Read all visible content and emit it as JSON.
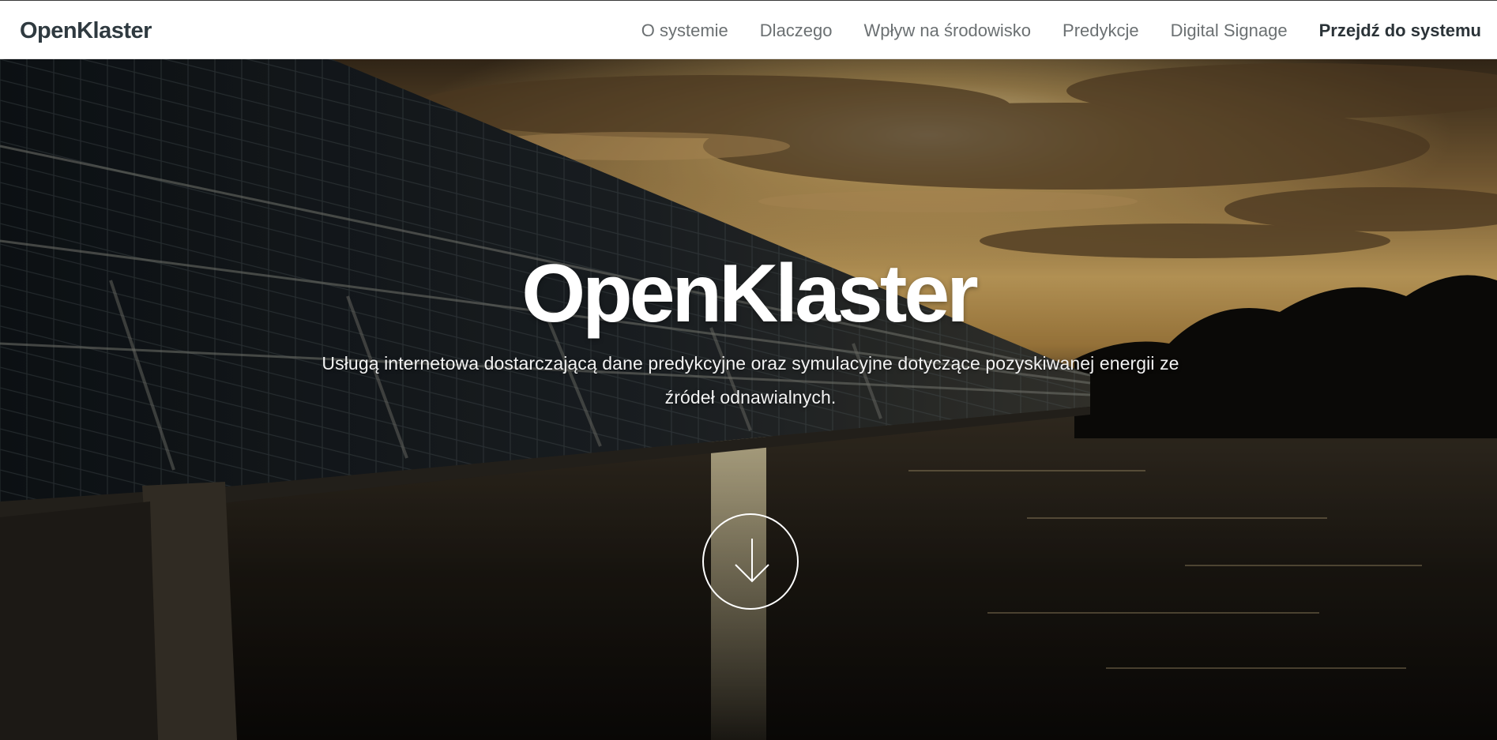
{
  "nav": {
    "brand": "OpenKlaster",
    "links": [
      "O systemie",
      "Dlaczego",
      "Wpływ na środowisko",
      "Predykcje",
      "Digital Signage"
    ],
    "cta": "Przejdź do systemu"
  },
  "hero": {
    "title": "OpenKlaster",
    "subtitle": "Usługą internetowa dostarczającą dane predykcyjne oraz symulacyjne dotyczące pozyskiwanej energii ze źródeł odnawialnych.",
    "scroll_icon": "arrow-down-icon",
    "background": "solar-panels-sunset-water-photo"
  },
  "colors": {
    "nav_background": "#ffffff",
    "brand_text": "#2f3a40",
    "nav_link": "#6b7072",
    "hero_text": "#ffffff"
  }
}
